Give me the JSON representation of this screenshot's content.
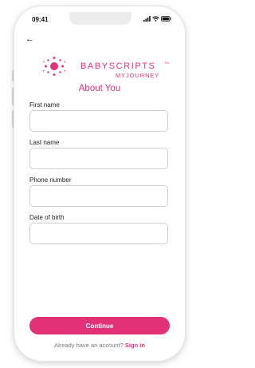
{
  "status_bar": {
    "time": "09:41"
  },
  "brand": {
    "name": "BABYSCRIPTS",
    "trademark": "TM",
    "subname": "MYJOURNEY",
    "color": "#e23177"
  },
  "page": {
    "title": "About You"
  },
  "form": {
    "fields": [
      {
        "label": "First name",
        "value": ""
      },
      {
        "label": "Last name",
        "value": ""
      },
      {
        "label": "Phone number",
        "value": ""
      },
      {
        "label": "Date of birth",
        "value": ""
      }
    ]
  },
  "actions": {
    "continue_label": "Continue",
    "signin_prompt": "Already have an account?",
    "signin_link": "Sign in"
  }
}
